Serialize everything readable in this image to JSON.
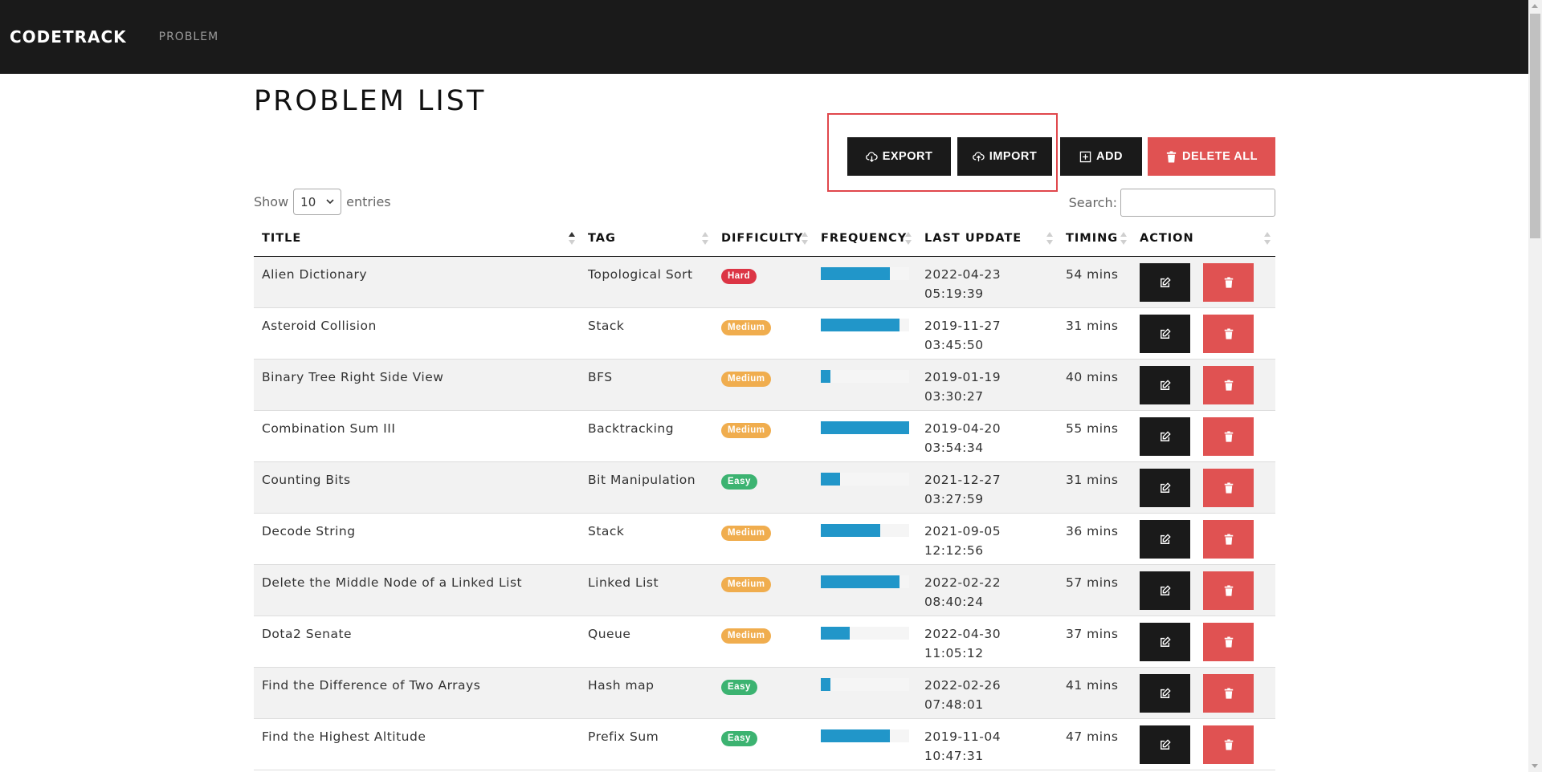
{
  "nav": {
    "brand": "CODETRACK",
    "link": "PROBLEM"
  },
  "page": {
    "title": "PROBLEM LIST"
  },
  "toolbar": {
    "export_label": "EXPORT",
    "import_label": "IMPORT",
    "add_label": "ADD",
    "delete_all_label": "DELETE ALL"
  },
  "controls": {
    "show_label": "Show",
    "entries_value": "10",
    "entries_label": "entries",
    "search_label": "Search:"
  },
  "columns": [
    "TITLE",
    "TAG",
    "DIFFICULTY",
    "FREQUENCY",
    "LAST UPDATE",
    "TIMING",
    "ACTION"
  ],
  "colors": {
    "Hard": "#dc3545",
    "Medium": "#f0ad4e",
    "Easy": "#3cb371",
    "frequency": "#2196c9"
  },
  "rows": [
    {
      "title": "Alien Dictionary",
      "tag": "Topological Sort",
      "difficulty": "Hard",
      "frequency": 0.78,
      "date": "2022-04-23",
      "time": "05:19:39",
      "timing": "54 mins"
    },
    {
      "title": "Asteroid Collision",
      "tag": "Stack",
      "difficulty": "Medium",
      "frequency": 0.89,
      "date": "2019-11-27",
      "time": "03:45:50",
      "timing": "31 mins"
    },
    {
      "title": "Binary Tree Right Side View",
      "tag": "BFS",
      "difficulty": "Medium",
      "frequency": 0.11,
      "date": "2019-01-19",
      "time": "03:30:27",
      "timing": "40 mins"
    },
    {
      "title": "Combination Sum III",
      "tag": "Backtracking",
      "difficulty": "Medium",
      "frequency": 1.0,
      "date": "2019-04-20",
      "time": "03:54:34",
      "timing": "55 mins"
    },
    {
      "title": "Counting Bits",
      "tag": "Bit Manipulation",
      "difficulty": "Easy",
      "frequency": 0.22,
      "date": "2021-12-27",
      "time": "03:27:59",
      "timing": "31 mins"
    },
    {
      "title": "Decode String",
      "tag": "Stack",
      "difficulty": "Medium",
      "frequency": 0.67,
      "date": "2021-09-05",
      "time": "12:12:56",
      "timing": "36 mins"
    },
    {
      "title": "Delete the Middle Node of a Linked List",
      "tag": "Linked List",
      "difficulty": "Medium",
      "frequency": 0.89,
      "date": "2022-02-22",
      "time": "08:40:24",
      "timing": "57 mins"
    },
    {
      "title": "Dota2 Senate",
      "tag": "Queue",
      "difficulty": "Medium",
      "frequency": 0.33,
      "date": "2022-04-30",
      "time": "11:05:12",
      "timing": "37 mins"
    },
    {
      "title": "Find the Difference of Two Arrays",
      "tag": "Hash map",
      "difficulty": "Easy",
      "frequency": 0.11,
      "date": "2022-02-26",
      "time": "07:48:01",
      "timing": "41 mins"
    },
    {
      "title": "Find the Highest Altitude",
      "tag": "Prefix Sum",
      "difficulty": "Easy",
      "frequency": 0.78,
      "date": "2019-11-04",
      "time": "10:47:31",
      "timing": "47 mins"
    }
  ]
}
